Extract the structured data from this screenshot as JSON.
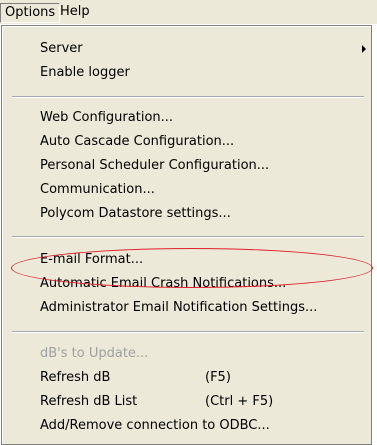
{
  "menubar": {
    "items": [
      {
        "label": "Options"
      },
      {
        "label": "Help"
      }
    ]
  },
  "options_menu": {
    "groups": [
      [
        {
          "label": "Server",
          "has_submenu": true
        },
        {
          "label": "Enable logger"
        }
      ],
      [
        {
          "label": "Web Configuration..."
        },
        {
          "label": "Auto Cascade Configuration..."
        },
        {
          "label": "Personal Scheduler Configuration..."
        },
        {
          "label": "Communication..."
        },
        {
          "label": "Polycom Datastore settings..."
        }
      ],
      [
        {
          "label": "E-mail Format...",
          "annotated": true
        },
        {
          "label": "Automatic Email Crash  Notifications..."
        },
        {
          "label": "Administrator Email Notification Settings..."
        }
      ],
      [
        {
          "label": "dB's to Update...",
          "disabled": true
        },
        {
          "label": "Refresh dB",
          "shortcut": "(F5)"
        },
        {
          "label": "Refresh dB List",
          "shortcut": "(Ctrl + F5)"
        },
        {
          "label": "Add/Remove connection to ODBC..."
        }
      ]
    ]
  },
  "annotation": {
    "color": "#e0202a",
    "shape": "ellipse"
  }
}
